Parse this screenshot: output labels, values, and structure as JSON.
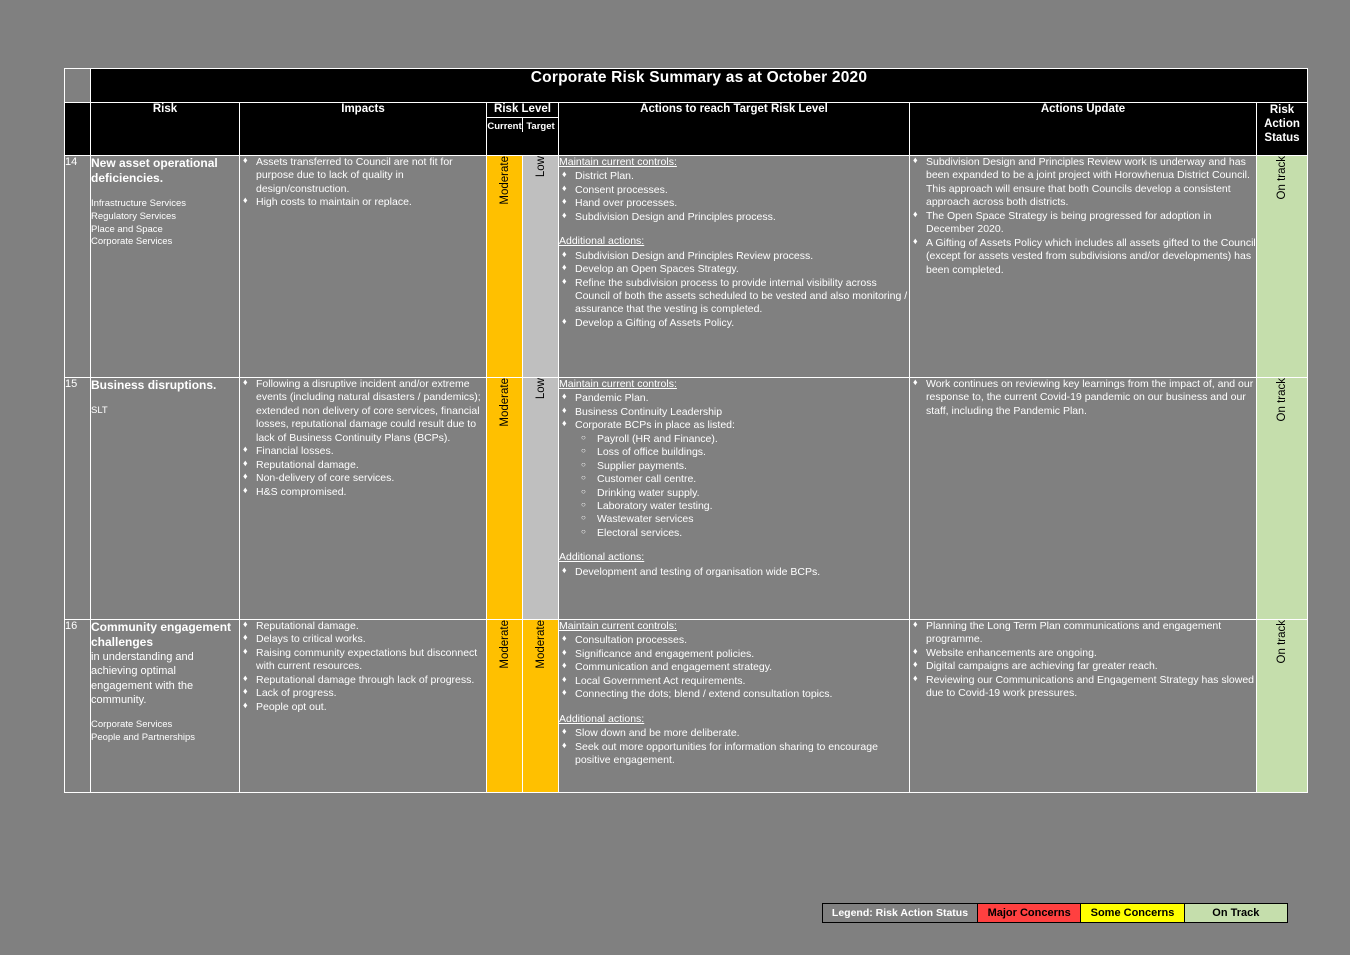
{
  "document": {
    "title": "Corporate Risk Summary as at October 2020"
  },
  "columns": {
    "number": "",
    "risk": "Risk",
    "impacts": "Impacts",
    "risk_level": "Risk Level",
    "risk_level_current": "Current",
    "risk_level_target": "Target",
    "actions": "Actions to reach Target Risk Level",
    "actions_update": "Actions Update",
    "status_line1": "Risk",
    "status_line2": "Action",
    "status_line3": "Status"
  },
  "section_headings": {
    "maintain": "Maintain current controls:",
    "additional": "Additional actions:"
  },
  "rows": [
    {
      "number": "14",
      "risk_title": "New asset operational deficiencies.",
      "risk_sub": "",
      "departments": "Infrastructure Services\nRegulatory Services\nPlace and Space\nCorporate Services",
      "impacts": [
        "Assets transferred to Council are not fit for purpose due to lack of quality in design/construction.",
        "High costs to maintain or replace."
      ],
      "current_level": "Moderate",
      "target_level": "Low",
      "maintain": [
        "District Plan.",
        "Consent processes.",
        "Hand over processes.",
        "Subdivision Design and Principles process."
      ],
      "additional": [
        "Subdivision Design and Principles Review process.",
        "Develop an Open Spaces Strategy.",
        "Refine the subdivision process to provide internal visibility across Council of both the assets scheduled to be vested and also monitoring / assurance that the vesting is completed.",
        "Develop a Gifting of Assets Policy."
      ],
      "updates": [
        "Subdivision Design and Principles Review work is underway and has been expanded to be a joint project with Horowhenua District Council. This approach will ensure that both Councils develop a consistent approach across both districts.",
        "The Open Space Strategy is being progressed for adoption in December 2020.",
        "A Gifting of Assets Policy which includes all assets gifted to the Council (except for assets vested from subdivisions and/or developments) has been completed."
      ],
      "status": "On track"
    },
    {
      "number": "15",
      "risk_title": "Business disruptions.",
      "risk_sub": "",
      "departments": "SLT",
      "impacts": [
        "Following a disruptive incident and/or extreme events (including natural disasters / pandemics); extended non delivery of core services, financial losses, reputational damage could result due to lack of Business Continuity Plans (BCPs).",
        "Financial losses.",
        "Reputational damage.",
        "Non-delivery of core services.",
        "H&S compromised."
      ],
      "current_level": "Moderate",
      "target_level": "Low",
      "maintain": [
        "Pandemic Plan.",
        "Business Continuity Leadership",
        "Corporate BCPs in place as listed:"
      ],
      "maintain_sub": [
        "Payroll (HR and Finance).",
        "Loss of office buildings.",
        "Supplier payments.",
        "Customer call centre.",
        "Drinking water supply.",
        "Laboratory water testing.",
        "Wastewater services",
        "Electoral services."
      ],
      "additional": [
        "Development and testing of organisation wide BCPs."
      ],
      "updates": [
        "Work continues on reviewing key learnings from the impact of, and our response to, the current Covid-19 pandemic on our business and our staff, including the Pandemic Plan."
      ],
      "status": "On track"
    },
    {
      "number": "16",
      "risk_title": "Community engagement challenges",
      "risk_sub": "in understanding and achieving optimal engagement with the community.",
      "departments": "Corporate Services\nPeople and Partnerships",
      "impacts": [
        "Reputational damage.",
        "Delays to critical works.",
        "Raising community expectations but disconnect with current resources.",
        "Reputational damage through lack of progress.",
        "Lack of progress.",
        "People opt out."
      ],
      "current_level": "Moderate",
      "target_level": "Moderate",
      "maintain": [
        "Consultation processes.",
        "Significance and engagement policies.",
        "Communication and engagement strategy.",
        "Local Government Act requirements.",
        "Connecting the dots; blend / extend consultation topics."
      ],
      "additional": [
        "Slow down and be more deliberate.",
        "Seek out more opportunities for information sharing to encourage positive engagement."
      ],
      "updates": [
        "Planning the Long Term Plan communications and engagement programme.",
        "Website enhancements are ongoing.",
        "Digital campaigns are achieving far greater reach.",
        "Reviewing our Communications and Engagement Strategy has slowed due to Covid-19 work pressures."
      ],
      "status": "On track"
    }
  ],
  "legend": {
    "label": "Legend: Risk Action Status",
    "items": [
      {
        "label": "Major Concerns",
        "color": "#FF4040"
      },
      {
        "label": "Some Concerns",
        "color": "#FFFF00"
      },
      {
        "label": "On Track",
        "color": "#C5DEAC"
      }
    ]
  },
  "colors": {
    "moderate": "#FFC000",
    "low": "#BFBFBF",
    "on_track": "#C5DEAC",
    "page_background": "#808080",
    "header_background": "#000000"
  }
}
